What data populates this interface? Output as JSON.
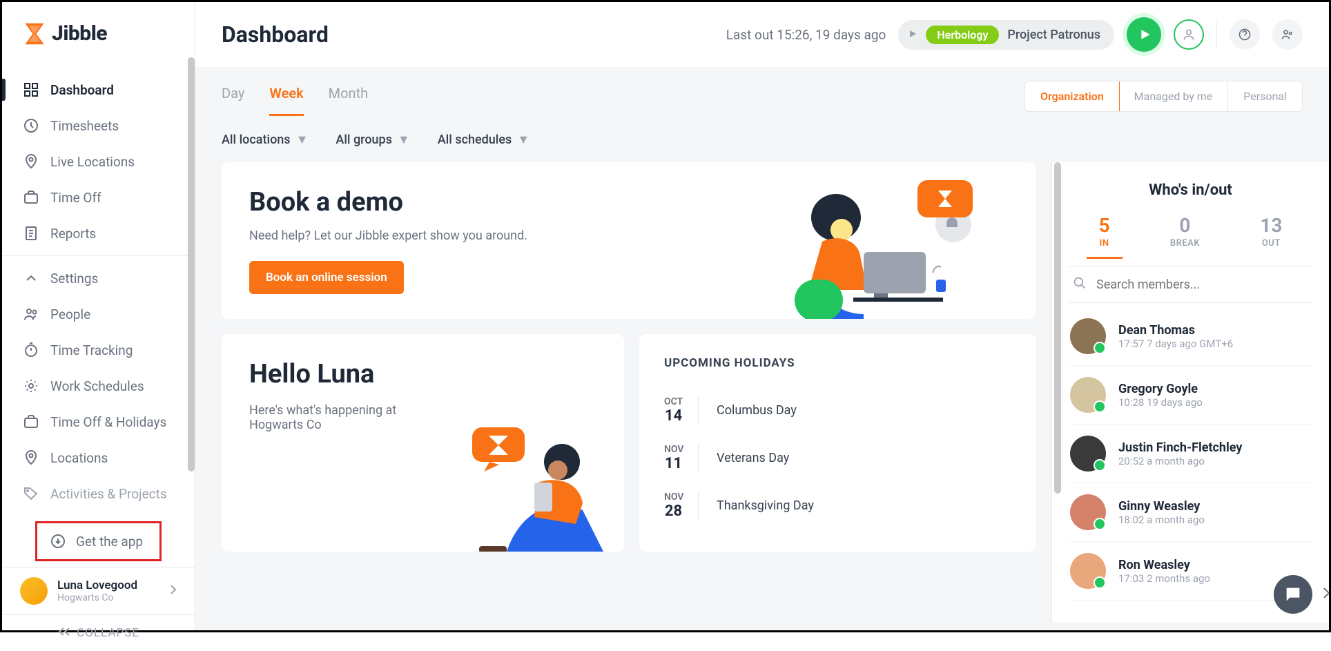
{
  "brand": "Jibble",
  "page_title": "Dashboard",
  "sidebar": {
    "group1": [
      {
        "label": "Dashboard",
        "active": true
      },
      {
        "label": "Timesheets"
      },
      {
        "label": "Live Locations"
      },
      {
        "label": "Time Off"
      },
      {
        "label": "Reports"
      }
    ],
    "group2": [
      {
        "label": "Settings"
      },
      {
        "label": "People"
      },
      {
        "label": "Time Tracking"
      },
      {
        "label": "Work Schedules"
      },
      {
        "label": "Time Off & Holidays"
      },
      {
        "label": "Locations"
      },
      {
        "label": "Activities & Projects"
      }
    ],
    "get_app": "Get the app",
    "user_name": "Luna Lovegood",
    "user_org": "Hogwarts Co",
    "collapse": "COLLAPSE"
  },
  "topbar": {
    "last_out": "Last out 15:26, 19 days ago",
    "tag": "Herbology",
    "project": "Project Patronus"
  },
  "tabs": {
    "day": "Day",
    "week": "Week",
    "month": "Month"
  },
  "views": {
    "org": "Organization",
    "managed": "Managed by me",
    "personal": "Personal"
  },
  "filters": {
    "locations": "All locations",
    "groups": "All groups",
    "schedules": "All schedules"
  },
  "demo": {
    "title": "Book a demo",
    "subtitle": "Need help? Let our Jibble expert show you around.",
    "cta": "Book an online session"
  },
  "hello": {
    "title": "Hello Luna",
    "subtitle": "Here's what's happening at Hogwarts Co"
  },
  "holidays": {
    "heading": "UPCOMING HOLIDAYS",
    "items": [
      {
        "month": "OCT",
        "day": "14",
        "name": "Columbus Day"
      },
      {
        "month": "NOV",
        "day": "11",
        "name": "Veterans Day"
      },
      {
        "month": "NOV",
        "day": "28",
        "name": "Thanksgiving Day"
      }
    ]
  },
  "who": {
    "title": "Who's in/out",
    "in": "5",
    "in_lbl": "IN",
    "break": "0",
    "break_lbl": "BREAK",
    "out": "13",
    "out_lbl": "OUT",
    "search_placeholder": "Search members...",
    "members": [
      {
        "name": "Dean Thomas",
        "time": "17:57 7 days ago GMT+6"
      },
      {
        "name": "Gregory Goyle",
        "time": "10:28 19 days ago"
      },
      {
        "name": "Justin Finch-Fletchley",
        "time": "20:52 a month ago"
      },
      {
        "name": "Ginny Weasley",
        "time": "18:02 a month ago"
      },
      {
        "name": "Ron Weasley",
        "time": "17:03 2 months ago"
      }
    ]
  }
}
